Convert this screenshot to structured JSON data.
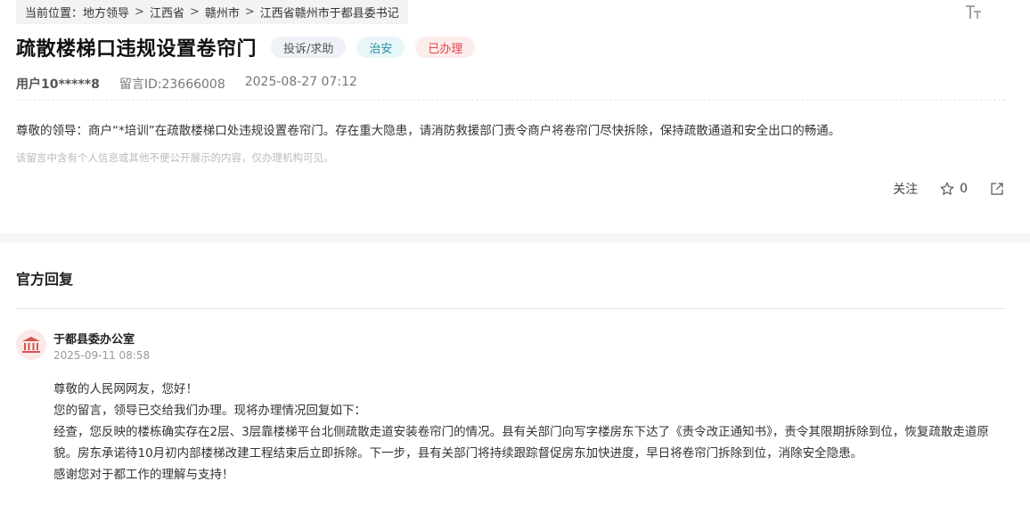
{
  "breadcrumb": {
    "prefix": "当前位置：",
    "items": [
      "地方领导",
      "江西省",
      "赣州市",
      "江西省赣州市于都县委书记"
    ]
  },
  "icons": {
    "font_size": "font-size-icon",
    "star": "star-icon",
    "share": "share-icon",
    "org": "government-building-icon"
  },
  "message": {
    "title": "疏散楼梯口违规设置卷帘门",
    "tags": {
      "type": "投诉/求助",
      "domain": "治安",
      "status": "已办理"
    },
    "user": "用户10*****8",
    "message_id": "留言ID:23666008",
    "time": "2025-08-27 07:12",
    "content": "尊敬的领导：商户“*培训”在疏散楼梯口处违规设置卷帘门。存在重大隐患，请消防救援部门责令商户将卷帘门尽快拆除，保持疏散通道和安全出口的畅通。",
    "privacy_note": "该留言中含有个人信息或其他不便公开展示的内容，仅办理机构可见。"
  },
  "actions": {
    "follow": "关注",
    "star_count": "0"
  },
  "reply": {
    "heading": "官方回复",
    "org": "于都县委办公室",
    "time": "2025-09-11 08:58",
    "paragraphs": [
      "尊敬的人民网网友，您好！",
      "您的留言，领导已交给我们办理。现将办理情况回复如下：",
      "经查，您反映的楼栋确实存在2层、3层靠楼梯平台北侧疏散走道安装卷帘门的情况。县有关部门向写字楼房东下达了《责令改正通知书》，责令其限期拆除到位，恢复疏散走道原貌。房东承诺待10月初内部楼梯改建工程结束后立即拆除。下一步，县有关部门将持续跟踪督促房东加快进度，早日将卷帘门拆除到位，消除安全隐患。",
      "感谢您对于都工作的理解与支持！"
    ]
  },
  "colors": {
    "tag_type_bg": "#eef1f6",
    "tag_domain_text": "#2a8fa3",
    "tag_status_text": "#e0454a",
    "avatar_bg": "#fbe9e9",
    "avatar_icon": "#d9534f"
  }
}
